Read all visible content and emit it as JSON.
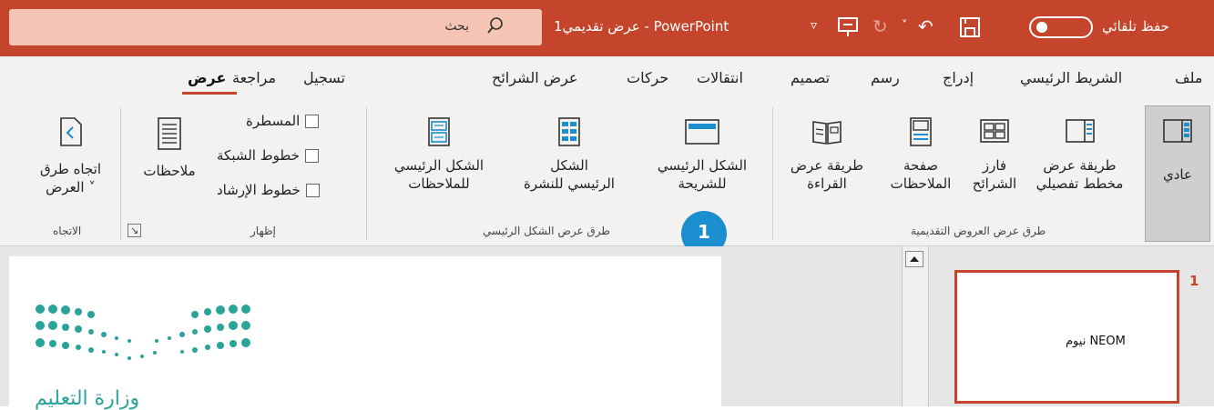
{
  "colors": {
    "titlebar": "#c4452b",
    "search_bg": "#f6c4b4",
    "ribbon": "#f3f2f1",
    "accent": "#c4452b",
    "callout": "#1b8ed0",
    "logo": "#2aa39a"
  },
  "titlebar": {
    "autosave_label": "حفظ تلقائي",
    "document_title": "عرض تقديمي1  -  PowerPoint",
    "search_placeholder": "بحث",
    "icons": [
      "save-icon",
      "redo-icon",
      "undo-icon",
      "present-icon",
      "customize-qat-icon",
      "search-icon"
    ]
  },
  "tabs": [
    {
      "label": "ملف"
    },
    {
      "label": "الشريط الرئيسي"
    },
    {
      "label": "إدراج"
    },
    {
      "label": "رسم"
    },
    {
      "label": "تصميم"
    },
    {
      "label": "انتقالات"
    },
    {
      "label": "حركات"
    },
    {
      "label": "عرض الشرائح"
    },
    {
      "label": "تسجيل"
    },
    {
      "label": "مراجعة"
    },
    {
      "label": "عرض",
      "active": true
    }
  ],
  "groups": {
    "presentation_views": {
      "label": "طرق عرض العروض التقديمية",
      "buttons": [
        {
          "line1": "عادي",
          "line2": "",
          "selected": true
        },
        {
          "line1": "طريقة عرض",
          "line2": "مخطط تفصيلي"
        },
        {
          "line1": "فارز",
          "line2": "الشرائح"
        },
        {
          "line1": "صفحة",
          "line2": "الملاحظات"
        },
        {
          "line1": "طريقة عرض",
          "line2": "القراءة"
        }
      ]
    },
    "master_views": {
      "label": "طرق عرض الشكل الرئيسي",
      "buttons": [
        {
          "line1": "الشكل الرئيسي",
          "line2": "للشريحة"
        },
        {
          "line1": "الشكل",
          "line2": "الرئيسي للنشرة"
        },
        {
          "line1": "الشكل الرئيسي",
          "line2": "للملاحظات"
        }
      ]
    },
    "show": {
      "label": "إظهار",
      "checkboxes": [
        "المسطرة",
        "خطوط الشبكة",
        "خطوط الإرشاد"
      ],
      "notes_label": "ملاحظات"
    },
    "direction": {
      "label": "الاتجاه",
      "line1": "اتجاه طرق",
      "line2": "العرض ˅"
    }
  },
  "callout": {
    "number": "1"
  },
  "slides_panel": {
    "slide_number": "1",
    "thumbnail_text": "نيوم NEOM"
  },
  "slide": {
    "logo_text": "وزارة التعليم"
  }
}
